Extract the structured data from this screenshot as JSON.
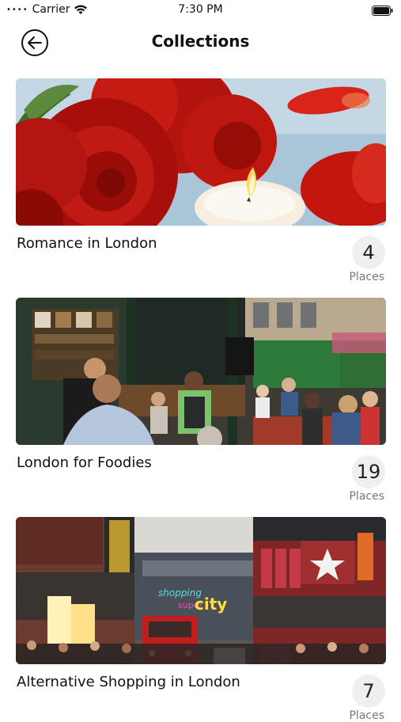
{
  "status_bar": {
    "carrier": "Carrier",
    "time": "7:30 PM"
  },
  "nav": {
    "title": "Collections",
    "back_icon": "back-arrow-icon"
  },
  "collections": [
    {
      "title": "Romance in London",
      "count": "4",
      "count_label": "Places",
      "image": "red-roses-candle"
    },
    {
      "title": "London for Foodies",
      "count": "19",
      "count_label": "Places",
      "image": "food-market"
    },
    {
      "title": "Alternative Shopping in London",
      "count": "7",
      "count_label": "Places",
      "image": "shopping-city-street"
    }
  ],
  "colors": {
    "badge_background": "#efefef",
    "label_gray": "#777777"
  }
}
